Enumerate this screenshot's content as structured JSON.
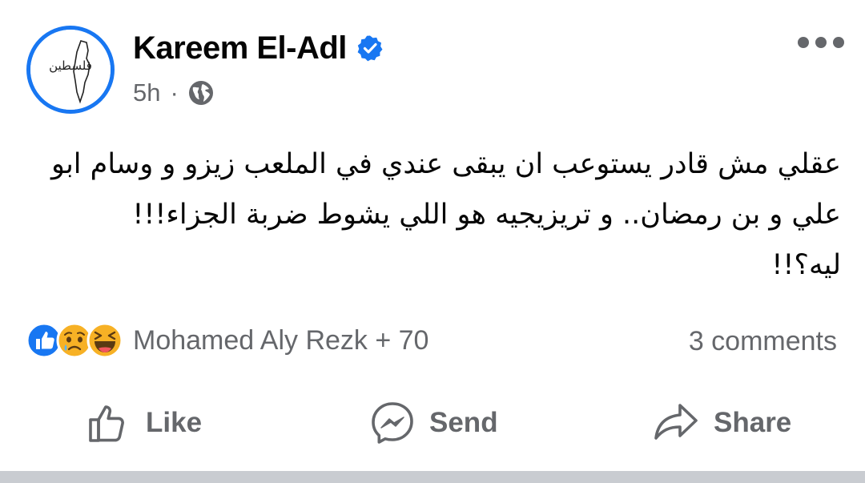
{
  "post": {
    "author": {
      "name": "Kareem El-Adl",
      "verified": true,
      "avatar_icon": "palestine-calligraphy-avatar",
      "avatar_text": "فلسطين"
    },
    "time": "5h",
    "separator": "·",
    "audience_icon": "globe-icon",
    "more_icon": "more-options-icon",
    "text": "عقلي مش قادر يستوعب ان يبقى عندي في الملعب زيزو و وسام ابو علي و بن رمضان.. و تريزيجيه هو اللي يشوط ضربة الجزاء!!!\nليه؟!!",
    "reactions": {
      "icons": [
        "like-reaction-icon",
        "sad-reaction-icon",
        "haha-reaction-icon"
      ],
      "summary": "Mohamed Aly Rezk + 70"
    },
    "comments_count": "3 comments",
    "actions": [
      {
        "label": "Like",
        "icon": "thumbs-up-icon"
      },
      {
        "label": "Send",
        "icon": "messenger-icon"
      },
      {
        "label": "Share",
        "icon": "share-arrow-icon"
      }
    ]
  },
  "colors": {
    "accent": "#1877f2",
    "secondary_text": "#65676b",
    "primary_text": "#050505",
    "divider": "#c9ccd1"
  }
}
